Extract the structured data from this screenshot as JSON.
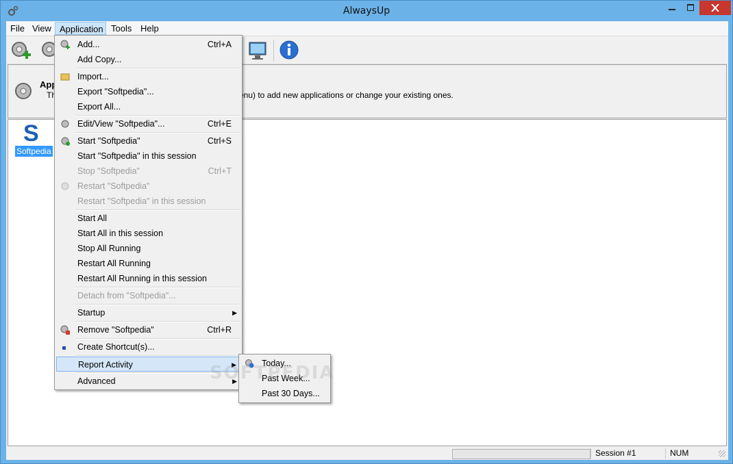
{
  "window": {
    "title": "AlwaysUp"
  },
  "menubar": {
    "items": [
      "File",
      "View",
      "Application",
      "Tools",
      "Help"
    ]
  },
  "info": {
    "title": "App",
    "desc_start": "Th",
    "desc_end": "enu) to add new applications or change your existing ones."
  },
  "apps": [
    {
      "name": "Softpedia",
      "letter": "S"
    }
  ],
  "dropdown": {
    "items": [
      {
        "label": "Add...",
        "shortcut": "Ctrl+A"
      },
      {
        "label": "Add Copy..."
      },
      {
        "label": "Import..."
      },
      {
        "label": "Export \"Softpedia\"..."
      },
      {
        "label": "Export All..."
      },
      {
        "label": "Edit/View \"Softpedia\"...",
        "shortcut": "Ctrl+E"
      },
      {
        "label": "Start \"Softpedia\"",
        "shortcut": "Ctrl+S"
      },
      {
        "label": "Start \"Softpedia\" in this session"
      },
      {
        "label": "Stop \"Softpedia\"",
        "shortcut": "Ctrl+T"
      },
      {
        "label": "Restart \"Softpedia\""
      },
      {
        "label": "Restart \"Softpedia\" in this session"
      },
      {
        "label": "Start All"
      },
      {
        "label": "Start All in this session"
      },
      {
        "label": "Stop All Running"
      },
      {
        "label": "Restart All Running"
      },
      {
        "label": "Restart All Running in this session"
      },
      {
        "label": "Detach from \"Softpedia\"..."
      },
      {
        "label": "Startup"
      },
      {
        "label": "Remove \"Softpedia\"",
        "shortcut": "Ctrl+R"
      },
      {
        "label": "Create Shortcut(s)..."
      },
      {
        "label": "Report Activity"
      },
      {
        "label": "Advanced"
      }
    ]
  },
  "submenu": {
    "items": [
      "Today...",
      "Past Week...",
      "Past 30 Days..."
    ]
  },
  "statusbar": {
    "session": "Session #1",
    "num": "NUM"
  },
  "watermark": "SOFTPEDIA"
}
